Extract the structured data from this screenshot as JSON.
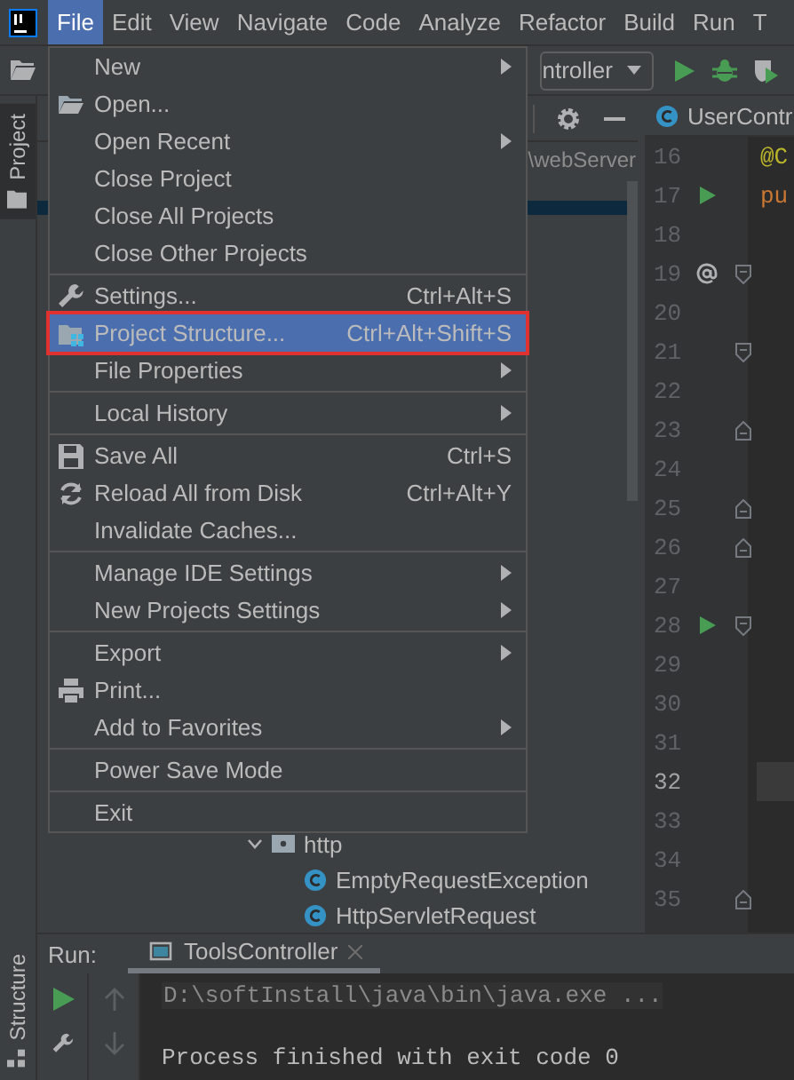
{
  "menu_bar": [
    {
      "label": "File",
      "selected": true
    },
    {
      "label": "Edit",
      "selected": false
    },
    {
      "label": "View",
      "selected": false
    },
    {
      "label": "Navigate",
      "selected": false
    },
    {
      "label": "Code",
      "selected": false
    },
    {
      "label": "Analyze",
      "selected": false
    },
    {
      "label": "Refactor",
      "selected": false
    },
    {
      "label": "Build",
      "selected": false
    },
    {
      "label": "Run",
      "selected": false
    },
    {
      "label": "T",
      "selected": false
    }
  ],
  "toolbar": {
    "run_config": "ntroller"
  },
  "tool_strip": [
    {
      "label": "Project",
      "selected": true
    },
    {
      "label": "Structure",
      "selected": false
    }
  ],
  "project_panel": {
    "path": "\\webServer",
    "tree": [
      {
        "label": "http",
        "kind": "package",
        "expanded": true,
        "children": [
          {
            "label": "EmptyRequestException",
            "kind": "class"
          },
          {
            "label": "HttpServletRequest",
            "kind": "class"
          }
        ]
      }
    ]
  },
  "editor": {
    "tab": "UserContr",
    "lines": [
      {
        "number": "16",
        "code": "@C",
        "kind": "annotation",
        "run_button": false,
        "override": false,
        "fold_start": false,
        "fold_end": false,
        "current": false
      },
      {
        "number": "17",
        "code": "pu",
        "kind": "keyword",
        "run_button": true,
        "override": false,
        "fold_start": false,
        "fold_end": false,
        "current": false
      },
      {
        "number": "18",
        "run_button": false,
        "override": false,
        "fold_start": false,
        "fold_end": false,
        "current": false
      },
      {
        "number": "19",
        "run_button": false,
        "override": true,
        "fold_start": true,
        "fold_end": false,
        "current": false
      },
      {
        "number": "20",
        "run_button": false,
        "override": false,
        "fold_start": false,
        "fold_end": false,
        "current": false
      },
      {
        "number": "21",
        "run_button": false,
        "override": false,
        "fold_start": true,
        "fold_end": false,
        "current": false
      },
      {
        "number": "22",
        "run_button": false,
        "override": false,
        "fold_start": false,
        "fold_end": false,
        "current": false
      },
      {
        "number": "23",
        "run_button": false,
        "override": false,
        "fold_start": false,
        "fold_end": true,
        "current": false
      },
      {
        "number": "24",
        "run_button": false,
        "override": false,
        "fold_start": false,
        "fold_end": false,
        "current": false
      },
      {
        "number": "25",
        "run_button": false,
        "override": false,
        "fold_start": false,
        "fold_end": true,
        "current": false
      },
      {
        "number": "26",
        "run_button": false,
        "override": false,
        "fold_start": false,
        "fold_end": true,
        "current": false
      },
      {
        "number": "27",
        "run_button": false,
        "override": false,
        "fold_start": false,
        "fold_end": false,
        "current": false
      },
      {
        "number": "28",
        "run_button": true,
        "override": false,
        "fold_start": true,
        "fold_end": false,
        "current": false
      },
      {
        "number": "29",
        "run_button": false,
        "override": false,
        "fold_start": false,
        "fold_end": false,
        "current": false
      },
      {
        "number": "30",
        "run_button": false,
        "override": false,
        "fold_start": false,
        "fold_end": false,
        "current": false
      },
      {
        "number": "31",
        "run_button": false,
        "override": false,
        "fold_start": false,
        "fold_end": false,
        "current": false
      },
      {
        "number": "32",
        "run_button": false,
        "override": false,
        "fold_start": false,
        "fold_end": false,
        "current": true
      },
      {
        "number": "33",
        "run_button": false,
        "override": false,
        "fold_start": false,
        "fold_end": false,
        "current": false
      },
      {
        "number": "34",
        "run_button": false,
        "override": false,
        "fold_start": false,
        "fold_end": false,
        "current": false
      },
      {
        "number": "35",
        "run_button": false,
        "override": false,
        "fold_start": false,
        "fold_end": true,
        "current": false
      }
    ]
  },
  "file_menu": {
    "items": [
      {
        "kind": "item",
        "label": "New",
        "submenu": true,
        "selected": false
      },
      {
        "kind": "folder",
        "label": "Open...",
        "submenu": false,
        "selected": false
      },
      {
        "kind": "item",
        "label": "Open Recent",
        "submenu": true,
        "selected": false
      },
      {
        "kind": "item",
        "label": "Close Project",
        "submenu": false,
        "selected": false
      },
      {
        "kind": "item",
        "label": "Close All Projects",
        "submenu": false,
        "selected": false
      },
      {
        "kind": "item",
        "label": "Close Other Projects",
        "submenu": false,
        "selected": false
      },
      {
        "kind": "separator"
      },
      {
        "kind": "wrench",
        "label": "Settings...",
        "shortcut": "Ctrl+Alt+S",
        "submenu": false,
        "selected": false
      },
      {
        "kind": "structure",
        "label": "Project Structure...",
        "shortcut": "Ctrl+Alt+Shift+S",
        "submenu": false,
        "selected": true,
        "annotated": true
      },
      {
        "kind": "item",
        "label": "File Properties",
        "submenu": true,
        "selected": false
      },
      {
        "kind": "separator"
      },
      {
        "kind": "item",
        "label": "Local History",
        "submenu": true,
        "selected": false
      },
      {
        "kind": "separator"
      },
      {
        "kind": "save",
        "label": "Save All",
        "shortcut": "Ctrl+S",
        "submenu": false,
        "selected": false
      },
      {
        "kind": "reload",
        "label": "Reload All from Disk",
        "shortcut": "Ctrl+Alt+Y",
        "submenu": false,
        "selected": false
      },
      {
        "kind": "item",
        "label": "Invalidate Caches...",
        "submenu": false,
        "selected": false
      },
      {
        "kind": "separator"
      },
      {
        "kind": "item",
        "label": "Manage IDE Settings",
        "submenu": true,
        "selected": false
      },
      {
        "kind": "item",
        "label": "New Projects Settings",
        "submenu": true,
        "selected": false
      },
      {
        "kind": "separator"
      },
      {
        "kind": "item",
        "label": "Export",
        "submenu": true,
        "selected": false
      },
      {
        "kind": "printer",
        "label": "Print...",
        "submenu": false,
        "selected": false
      },
      {
        "kind": "item",
        "label": "Add to Favorites",
        "submenu": true,
        "selected": false
      },
      {
        "kind": "separator"
      },
      {
        "kind": "item",
        "label": "Power Save Mode",
        "submenu": false,
        "selected": false
      },
      {
        "kind": "separator"
      },
      {
        "kind": "item",
        "label": "Exit",
        "submenu": false,
        "selected": false
      }
    ]
  },
  "run_panel": {
    "label": "Run:",
    "tab": "ToolsController",
    "console": [
      {
        "text": "D:\\softInstall\\java\\bin\\java.exe ...",
        "kind": "command"
      },
      {
        "text": "Process finished with exit code 0",
        "kind": "output"
      }
    ]
  }
}
